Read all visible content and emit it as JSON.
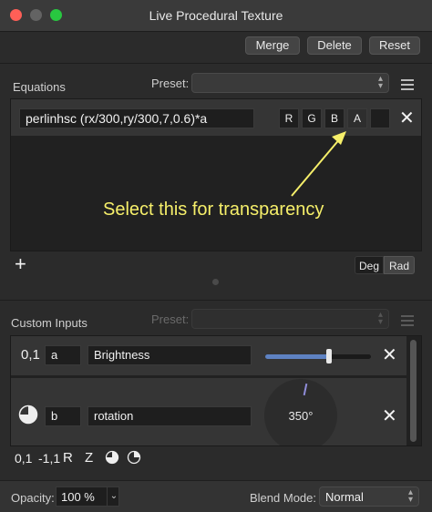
{
  "window": {
    "title": "Live Procedural Texture"
  },
  "toolbar": {
    "merge": "Merge",
    "delete": "Delete",
    "reset": "Reset"
  },
  "equations": {
    "heading": "Equations",
    "preset_label": "Preset:",
    "preset_value": "",
    "equation": "perlinhsc (rx/300,ry/300,7,0.6)*a",
    "channels": [
      "R",
      "G",
      "B",
      "A"
    ],
    "selected_channel": "A",
    "annotation": "Select this for transparency",
    "add": "+",
    "angle_units": [
      "Deg",
      "Rad"
    ],
    "angle_selected": "Rad"
  },
  "custom_inputs": {
    "heading": "Custom Inputs",
    "preset_label": "Preset:",
    "rows": [
      {
        "type_label": "0,1",
        "var": "a",
        "name": "Brightness",
        "slider_value": 0.6
      },
      {
        "var": "b",
        "name": "rotation",
        "angle_value": "350°"
      }
    ],
    "types": [
      "0,1",
      "-1,1",
      "R",
      "Z"
    ]
  },
  "footer": {
    "opacity_label": "Opacity:",
    "opacity_value": "100 %",
    "blend_label": "Blend Mode:",
    "blend_value": "Normal"
  },
  "colors": {
    "accent": "#5e82c2",
    "annotation": "#f6ef6a",
    "close": "#ff5f57",
    "minimize": "#636363",
    "zoom": "#28c840"
  },
  "icons": [
    "close-icon",
    "menu-icon",
    "plus-icon",
    "dial-icon",
    "pie-icon",
    "chevron-updown-icon"
  ]
}
